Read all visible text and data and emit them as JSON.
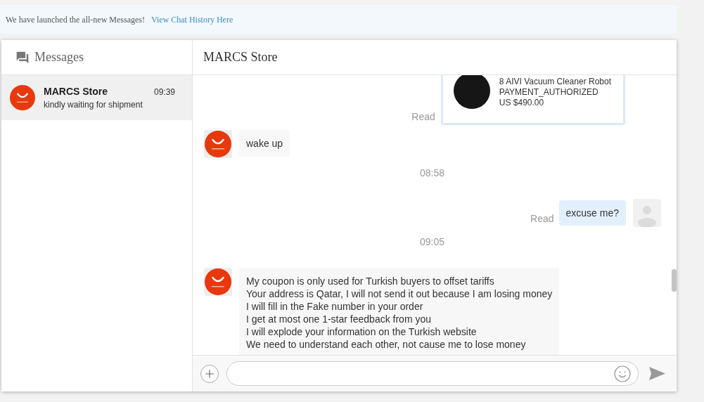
{
  "banner": {
    "text": "We have launched the all-new Messages!",
    "link": "View Chat History Here"
  },
  "sidebar": {
    "title": "Messages",
    "conversations": [
      {
        "name": "MARCS Store",
        "time": "09:39",
        "preview": "kindly waiting for shipment",
        "selected": true
      }
    ]
  },
  "chat": {
    "title": "MARCS Store",
    "messages": [
      {
        "kind": "product",
        "status": "Read",
        "title": "8 AIVI Vacuum Cleaner Robot",
        "state": "PAYMENT_AUTHORIZED",
        "price": "US $490.00"
      },
      {
        "kind": "incoming",
        "text": "wake up"
      },
      {
        "kind": "time",
        "text": "08:58"
      },
      {
        "kind": "outgoing",
        "status": "Read",
        "text": "excuse me?"
      },
      {
        "kind": "time",
        "text": "09:05"
      },
      {
        "kind": "incoming",
        "text": "My coupon is only used for Turkish buyers to offset tariffs\nYour address is Qatar, I will not send it out because I am losing money\nI will fill in the Fake number in your order\nI get at most one 1-star feedback from you\nI will explode your information on the Turkish website\nWe need to understand each other, not cause me to lose money"
      }
    ]
  }
}
